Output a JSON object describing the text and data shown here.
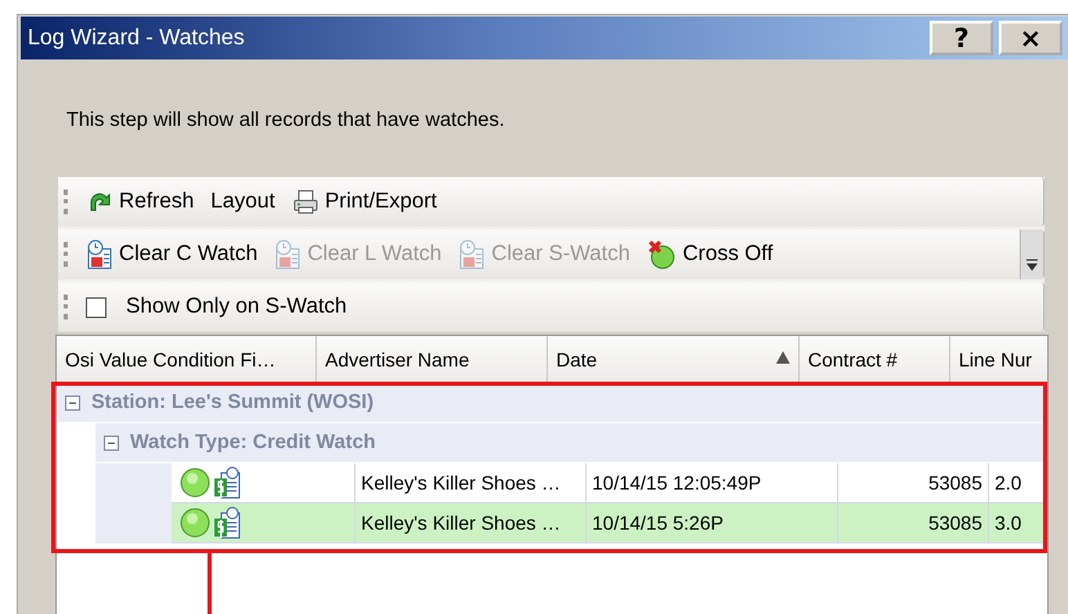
{
  "window": {
    "title": "Log Wizard - Watches",
    "buttons": [
      "?",
      "×"
    ]
  },
  "intro": "This step will show all records that have watches.",
  "toolbars": [
    {
      "items": [
        {
          "kind": "refresh",
          "label": "Refresh",
          "disabled": false
        },
        {
          "kind": "text",
          "label": "Layout",
          "disabled": false
        },
        {
          "kind": "print",
          "label": "Print/Export",
          "disabled": false
        }
      ]
    },
    {
      "items": [
        {
          "kind": "clear",
          "label": "Clear C Watch",
          "disabled": false
        },
        {
          "kind": "clear",
          "label": "Clear L Watch",
          "disabled": true
        },
        {
          "kind": "clear",
          "label": "Clear S-Watch",
          "disabled": true
        },
        {
          "kind": "cross",
          "label": "Cross Off",
          "disabled": false
        }
      ],
      "overflow": true
    },
    {
      "items": [
        {
          "kind": "checkbox",
          "label": "Show Only on S-Watch",
          "checked": false
        }
      ]
    }
  ],
  "table": {
    "columns": [
      {
        "label": "Osi Value Condition Fi…",
        "sorted": false
      },
      {
        "label": "Advertiser Name",
        "sorted": false
      },
      {
        "label": "Date",
        "sorted": true
      },
      {
        "label": "Contract #",
        "sorted": false
      },
      {
        "label": "Line Nur",
        "sorted": false
      }
    ],
    "groups": [
      {
        "label": "Station: Lee's Summit (WOSI)",
        "expanded": true,
        "children": [
          {
            "label": "Watch Type: Credit Watch",
            "expanded": true,
            "rows": [
              {
                "selected": false,
                "cells": [
                  "Kelley's Killer Shoes …",
                  "10/14/15 12:05:49P",
                  "53085",
                  "2.0"
                ]
              },
              {
                "selected": true,
                "cells": [
                  "Kelley's Killer Shoes …",
                  "10/14/15 5:26P",
                  "53085",
                  "3.0"
                ]
              }
            ]
          }
        ]
      }
    ]
  },
  "annotation": {
    "kind": "highlight"
  }
}
